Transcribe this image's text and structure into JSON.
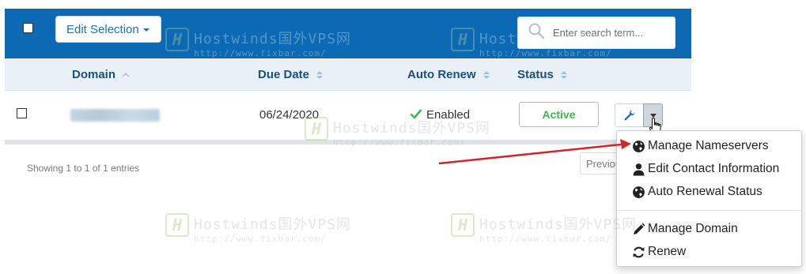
{
  "toolbar": {
    "edit_selection_label": "Edit Selection",
    "search_placeholder": "Enter search term..."
  },
  "table": {
    "columns": [
      {
        "label": "Domain"
      },
      {
        "label": "Due Date"
      },
      {
        "label": "Auto Renew"
      },
      {
        "label": "Status"
      }
    ],
    "rows": [
      {
        "domain": "",
        "due_date": "06/24/2020",
        "auto_renew": "Enabled",
        "status": "Active"
      }
    ]
  },
  "footer": {
    "entries_text": "Showing 1 to 1 of 1 entries",
    "prev_label": "Previous"
  },
  "dropdown_menu": {
    "items": [
      {
        "label": "Manage Nameservers",
        "icon": "globe-icon"
      },
      {
        "label": "Edit Contact Information",
        "icon": "user-icon"
      },
      {
        "label": "Auto Renewal Status",
        "icon": "globe-icon"
      },
      {
        "label": "Manage Domain",
        "icon": "pencil-icon"
      },
      {
        "label": "Renew",
        "icon": "refresh-icon"
      }
    ]
  },
  "watermark": {
    "title": "Hostwinds国外VPS网",
    "url": "http://www.fixbar.com/"
  },
  "colors": {
    "toolbar": "#0b6ab3",
    "header_row": "#e9f0f7",
    "header_text": "#1b4f7c",
    "status_active": "#3cb94a",
    "annotation_arrow": "#d0252b"
  }
}
